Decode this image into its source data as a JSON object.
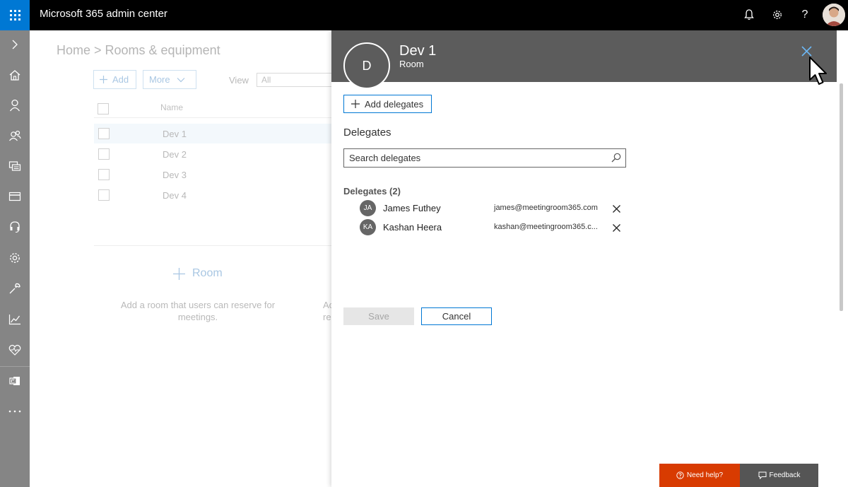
{
  "app": {
    "title": "Microsoft 365 admin center"
  },
  "topbar": {
    "icons": [
      "waffle-icon",
      "bell-icon",
      "gear-icon",
      "help-icon",
      "user-avatar"
    ],
    "help_glyph": "?"
  },
  "rail": {
    "items": [
      "expand-icon",
      "home-icon",
      "user-icon",
      "groups-icon",
      "resources-icon",
      "billing-icon",
      "support-icon",
      "settings-icon",
      "setup-icon",
      "reports-icon",
      "health-icon",
      "exchange-icon",
      "more-icon"
    ]
  },
  "page": {
    "breadcrumb": "Home > Rooms & equipment",
    "toolbar": {
      "add_label": "Add",
      "more_label": "More",
      "view_label": "View",
      "view_value": "All"
    },
    "table": {
      "column_name": "Name",
      "rows": [
        "Dev 1",
        "Dev 2",
        "Dev 3",
        "Dev 4"
      ]
    },
    "empty": {
      "room_label": "Room",
      "room_desc": "Add a room that users can reserve for meetings.",
      "second_desc_fragment": "Ac re"
    }
  },
  "panel": {
    "avatar_letter": "D",
    "title": "Dev 1",
    "subtitle": "Room",
    "add_delegates_label": "Add delegates",
    "section_title": "Delegates",
    "search_placeholder": "Search delegates",
    "list_title": "Delegates (2)",
    "delegates": [
      {
        "initials": "JA",
        "name": "James Futhey",
        "email": "james@meetingroom365.com"
      },
      {
        "initials": "KA",
        "name": "Kashan Heera",
        "email": "kashan@meetingroom365.c..."
      }
    ],
    "save_label": "Save",
    "cancel_label": "Cancel"
  },
  "footer": {
    "need_help_label": "Need help?",
    "feedback_label": "Feedback"
  },
  "colors": {
    "accent": "#0078d4",
    "topbar": "#000000",
    "rail": "#858585",
    "panel_header": "#5c5c5c",
    "need_help": "#d83b01",
    "feedback": "#555555"
  }
}
